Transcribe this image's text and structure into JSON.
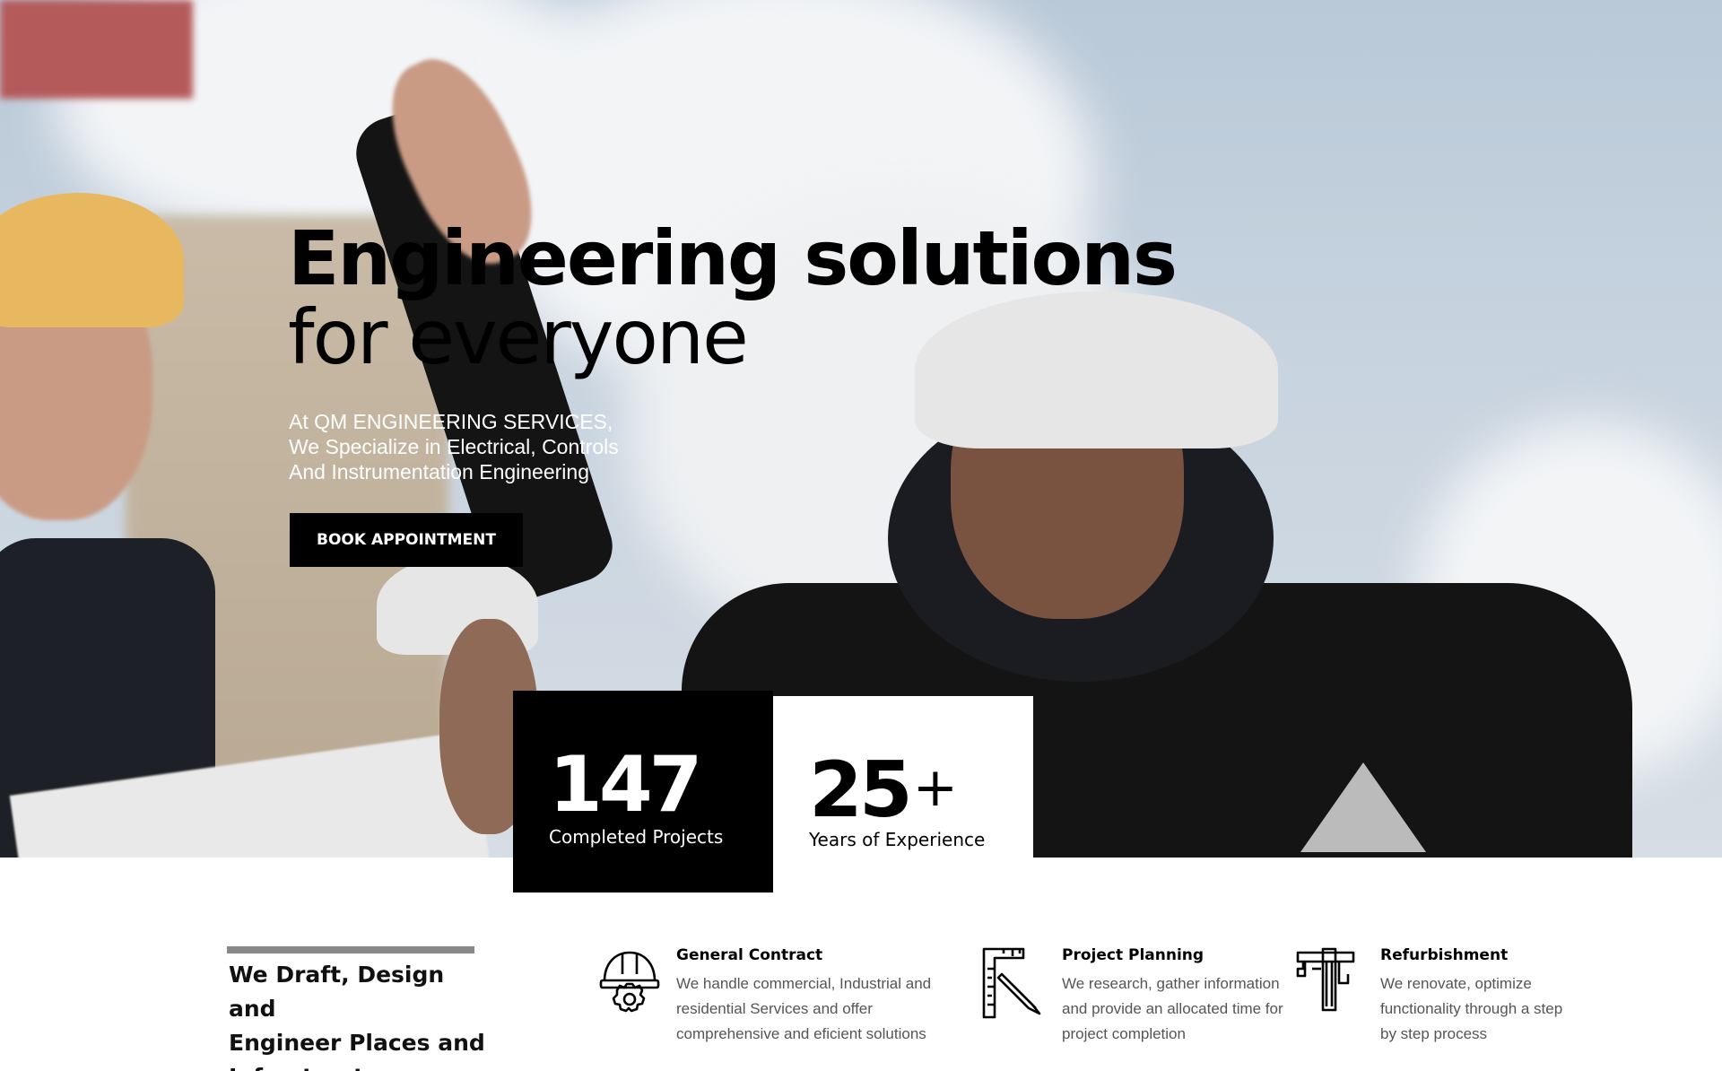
{
  "hero": {
    "title_line1": "Engineering solutions",
    "title_line2": "for everyone",
    "subtitle_lines": [
      "At QM ENGINEERING SERVICES,",
      "We Specialize in Electrical, Controls",
      "And Instrumentation Engineering"
    ],
    "cta_label": "BOOK APPOINTMENT"
  },
  "stats": [
    {
      "number": "147",
      "suffix": "",
      "label": "Completed Projects",
      "style": "dark"
    },
    {
      "number": "25",
      "suffix": "+",
      "label": "Years of Experience",
      "style": "light"
    }
  ],
  "intro": {
    "lines": [
      "We Draft, Design and",
      "Engineer Places and",
      "Infrastructures"
    ]
  },
  "services": [
    {
      "icon": "helmet-gear-icon",
      "title": "General Contract",
      "desc_lines": [
        "We handle commercial, Industrial and",
        "residential Services and offer",
        "comprehensive and eficient solutions"
      ]
    },
    {
      "icon": "ruler-pencil-icon",
      "title": "Project Planning",
      "desc_lines": [
        "We research, gather information",
        "and provide an allocated time for",
        "project completion"
      ]
    },
    {
      "icon": "caliper-icon",
      "title": "Refurbishment",
      "desc_lines": [
        "We renovate, optimize",
        "functionality through a step",
        "by step process"
      ]
    }
  ],
  "colors": {
    "accent_dark": "#000000",
    "divider_gray": "#888888",
    "text_muted": "#555555"
  }
}
